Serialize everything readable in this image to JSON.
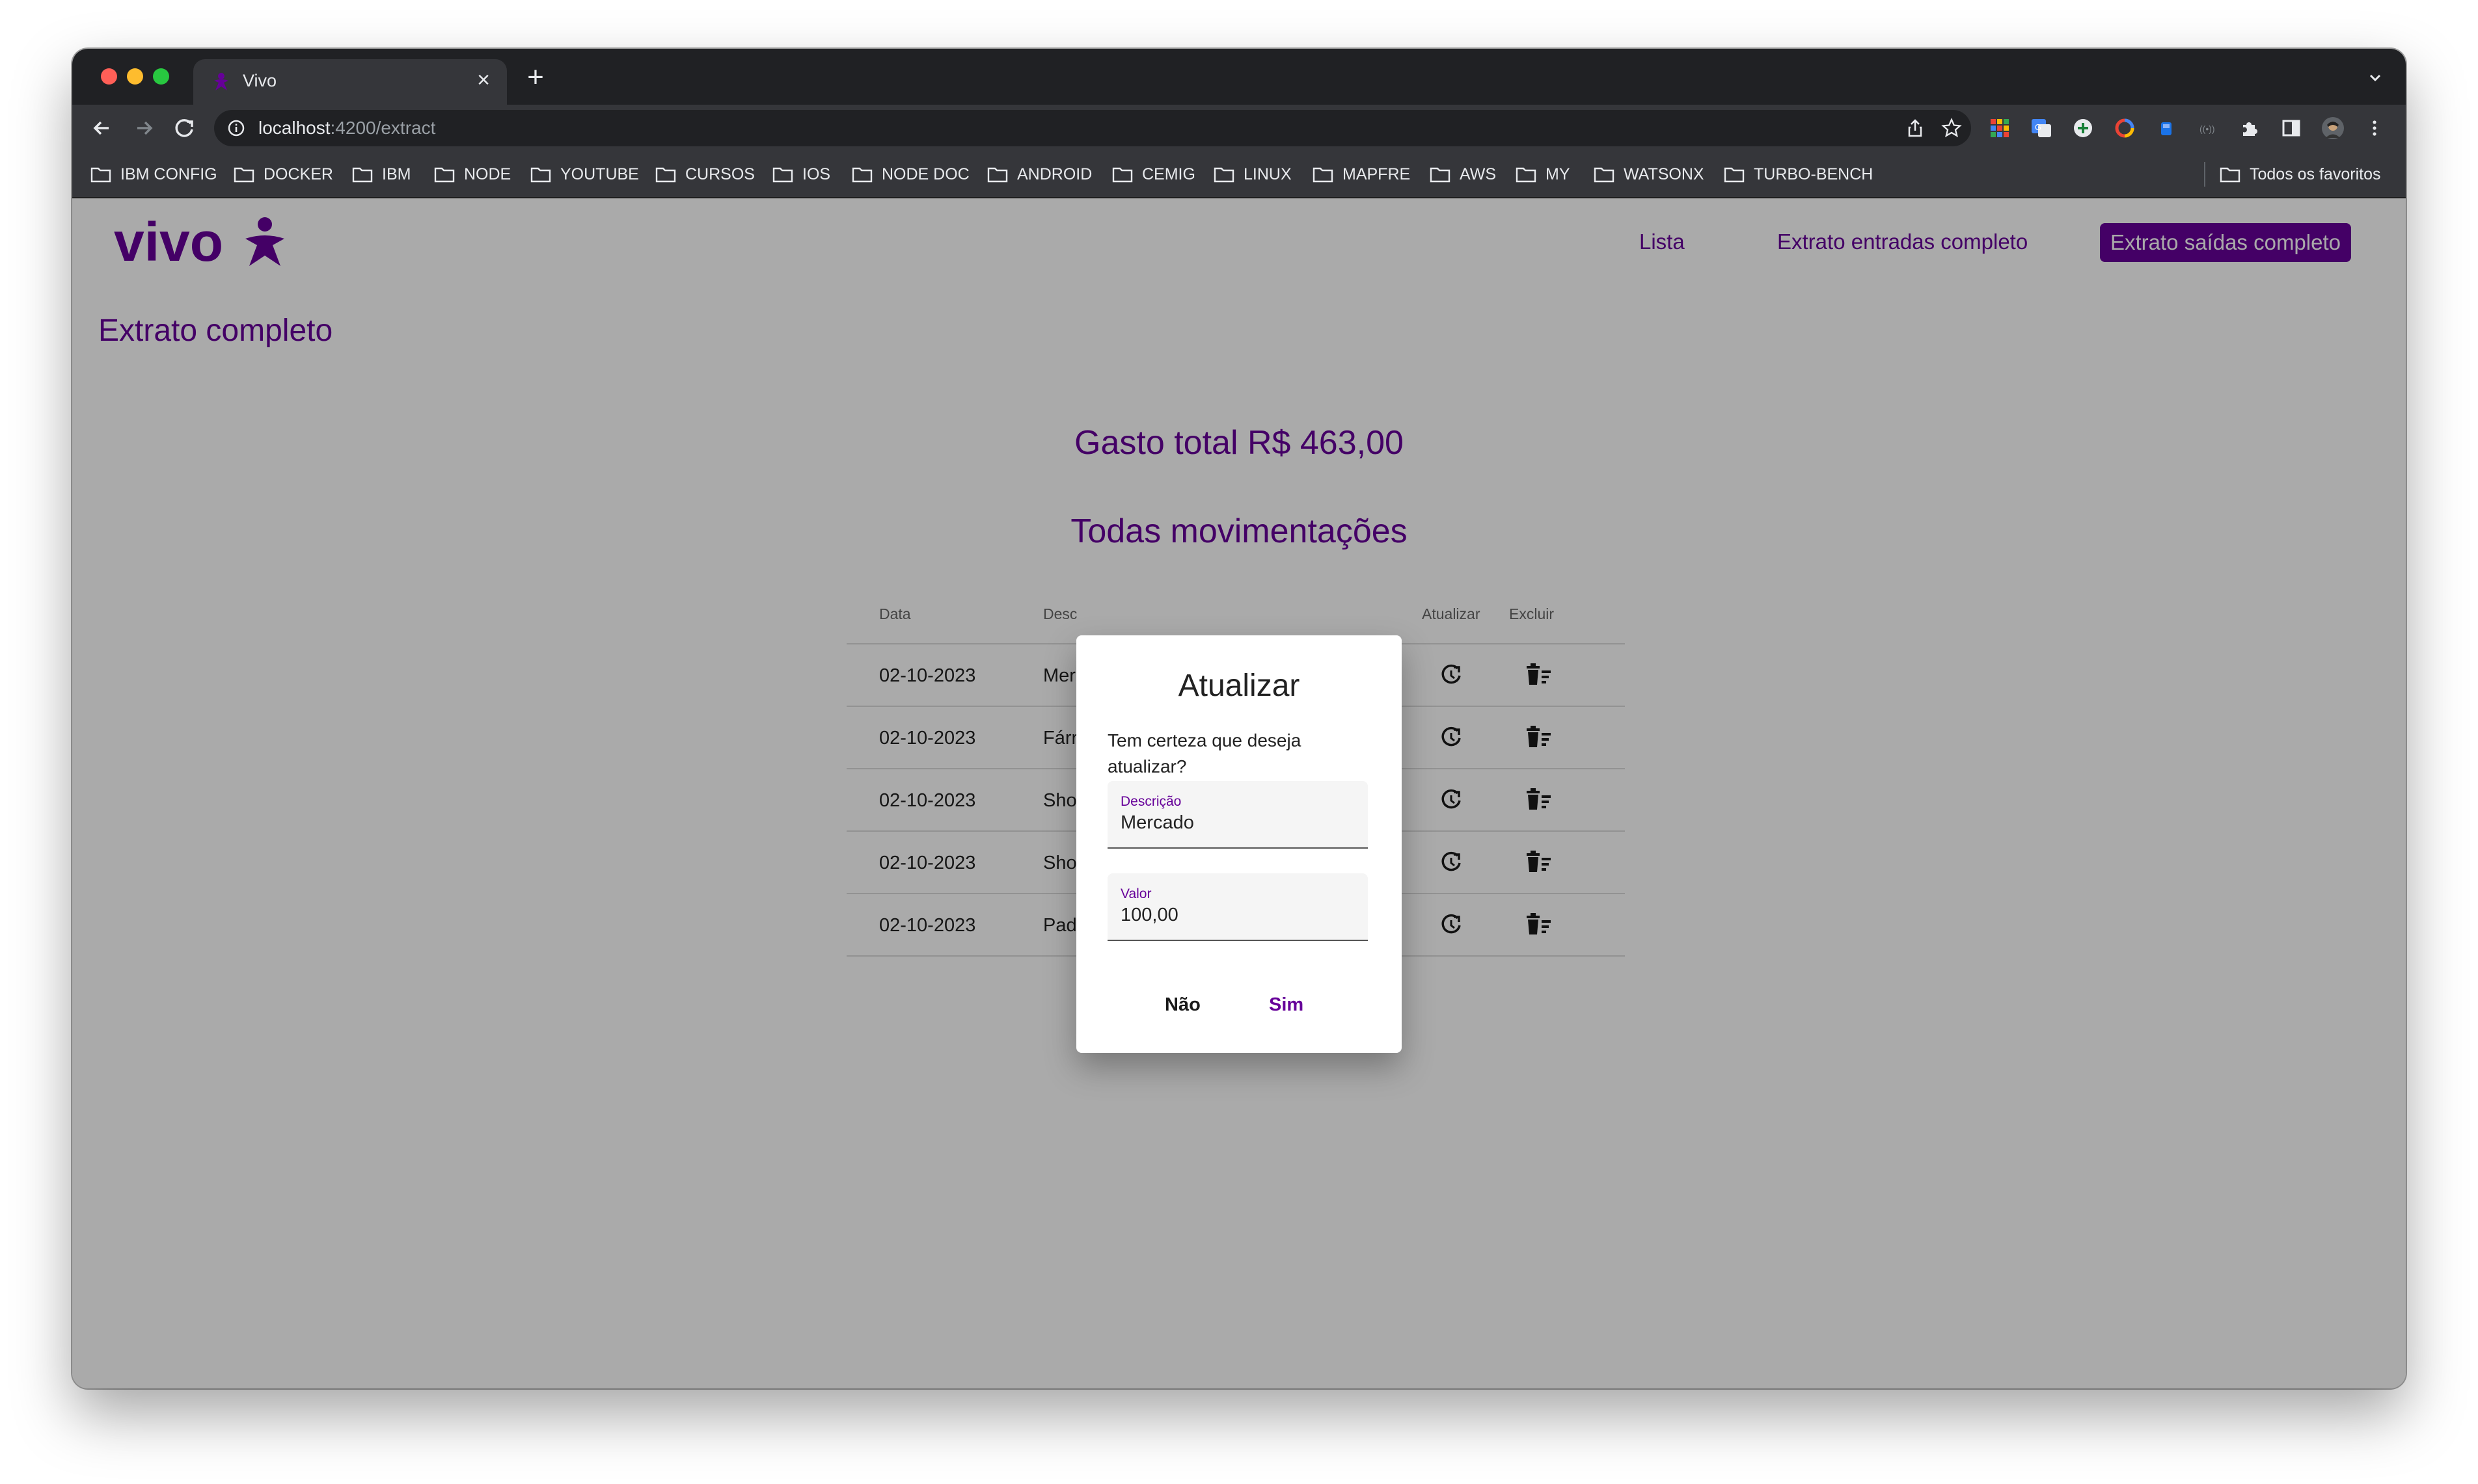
{
  "browser": {
    "tab_title": "Vivo",
    "url_host": "localhost",
    "url_path": ":4200/extract",
    "bookmarks": [
      "IBM CONFIG",
      "DOCKER",
      "IBM",
      "NODE",
      "YOUTUBE",
      "CURSOS",
      "IOS",
      "NODE DOC",
      "ANDROID",
      "CEMIG",
      "LINUX",
      "MAPFRE",
      "AWS",
      "MY",
      "WATSONX",
      "TURBO-BENCH"
    ],
    "all_bookmarks_label": "Todos os favoritos"
  },
  "header": {
    "logo_text": "vivo",
    "nav_list": "Lista",
    "nav_in": "Extrato entradas completo",
    "nav_out": "Extrato saídas completo"
  },
  "main": {
    "page_title": "Extrato completo",
    "total": "Gasto total R$ 463,00",
    "subtitle": "Todas movimentações"
  },
  "table": {
    "headers": {
      "date": "Data",
      "desc": "Desc",
      "update": "Atualizar",
      "delete": "Excluir"
    },
    "rows": [
      {
        "date": "02-10-2023",
        "desc": "Mer"
      },
      {
        "date": "02-10-2023",
        "desc": "Fárr"
      },
      {
        "date": "02-10-2023",
        "desc": "Sho"
      },
      {
        "date": "02-10-2023",
        "desc": "Sho"
      },
      {
        "date": "02-10-2023",
        "desc": "Pad"
      }
    ]
  },
  "dialog": {
    "title": "Atualizar",
    "message": "Tem certeza que deseja atualizar?",
    "desc_label": "Descrição",
    "desc_value": "Mercado",
    "value_label": "Valor",
    "value_value": "100,00",
    "no_label": "Não",
    "yes_label": "Sim"
  },
  "colors": {
    "brand": "#660099",
    "overlay": "rgba(0,0,0,0.335)",
    "chrome_dark": "#202124",
    "chrome": "#35363a"
  }
}
